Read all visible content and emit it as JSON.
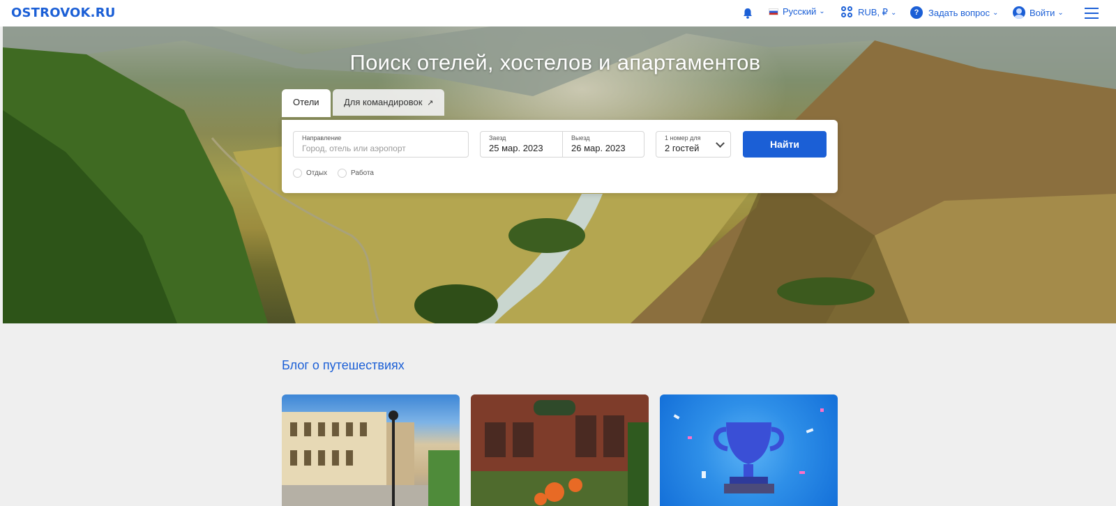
{
  "header": {
    "logo": "OSTROVOK.RU",
    "language": "Русский",
    "currency": "RUB, ₽",
    "help": "Задать вопрос",
    "login": "Войти"
  },
  "icons": {
    "bell": "bell-icon",
    "flag": "russia-flag-icon",
    "currency": "currency-icon",
    "help": "question-icon",
    "user": "user-icon",
    "menu": "hamburger-icon",
    "external": "external-link-icon"
  },
  "hero": {
    "title": "Поиск отелей, хостелов и апартаментов"
  },
  "search": {
    "tabs": [
      {
        "label": "Отели"
      },
      {
        "label": "Для командировок"
      }
    ],
    "destination": {
      "label": "Направление",
      "placeholder": "Город, отель или аэропорт"
    },
    "checkin": {
      "label": "Заезд",
      "value": "25 мар. 2023"
    },
    "checkout": {
      "label": "Выезд",
      "value": "26 мар. 2023"
    },
    "guests": {
      "label": "1 номер для",
      "value": "2 гостей"
    },
    "submit": "Найти",
    "trip_types": [
      {
        "label": "Отдых"
      },
      {
        "label": "Работа"
      }
    ]
  },
  "blog": {
    "title": "Блог о путешествиях"
  },
  "colors": {
    "accent": "#1b5fd6",
    "page_bg": "#efefef"
  }
}
